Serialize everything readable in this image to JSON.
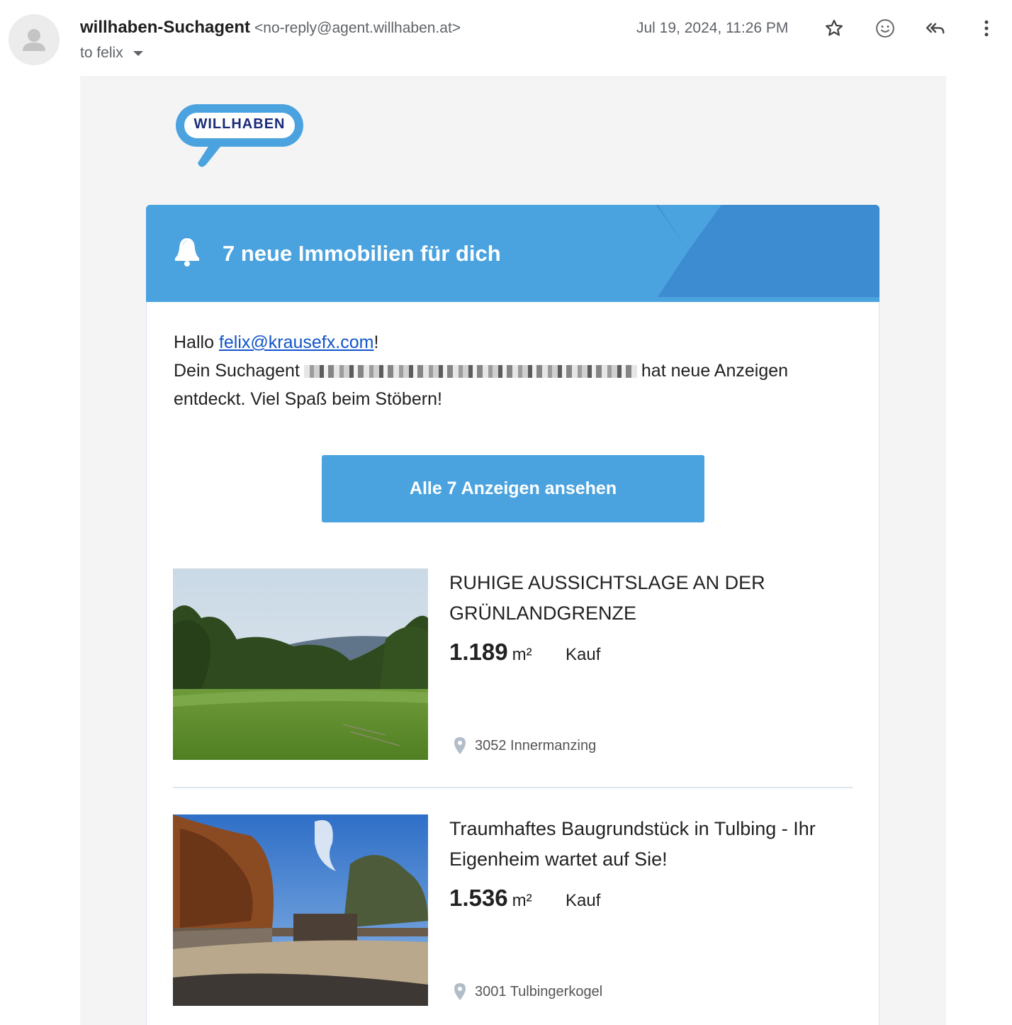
{
  "header": {
    "sender_name": "willhaben-Suchagent",
    "sender_email": "<no-reply@agent.willhaben.at>",
    "to_label": "to felix",
    "date": "Jul 19, 2024, 11:26 PM",
    "icons": [
      "star-icon",
      "emoji-icon",
      "reply-all-icon",
      "more-vert-icon"
    ]
  },
  "email": {
    "logo_text": "WILLHABEN",
    "banner_title": "7 neue Immobilien für dich",
    "greeting": {
      "hello": "Hallo",
      "email_link": "felix@krausefx.com",
      "exclaim": "!",
      "line2_start": "Dein Suchagent",
      "line2_end": "hat neue Anzeigen entdeckt. Viel Spaß beim Stöbern!"
    },
    "cta_label": "Alle 7 Anzeigen ansehen",
    "listings": [
      {
        "title": "RUHIGE AUSSICHTSLAGE AN DER GRÜNLANDGRENZE",
        "area": "1.189",
        "unit": "m²",
        "type": "Kauf",
        "location": "3052 Innermanzing"
      },
      {
        "title": "Traumhaftes Baugrundstück in Tulbing - Ihr Eigenheim wartet auf Sie!",
        "area": "1.536",
        "unit": "m²",
        "type": "Kauf",
        "location": "3001 Tulbingerkogel"
      }
    ]
  },
  "colors": {
    "brand_blue": "#4aa3df",
    "brand_dark_blue": "#3d8bd0",
    "logo_navy": "#1a2c7a",
    "link_blue": "#1155cc"
  }
}
